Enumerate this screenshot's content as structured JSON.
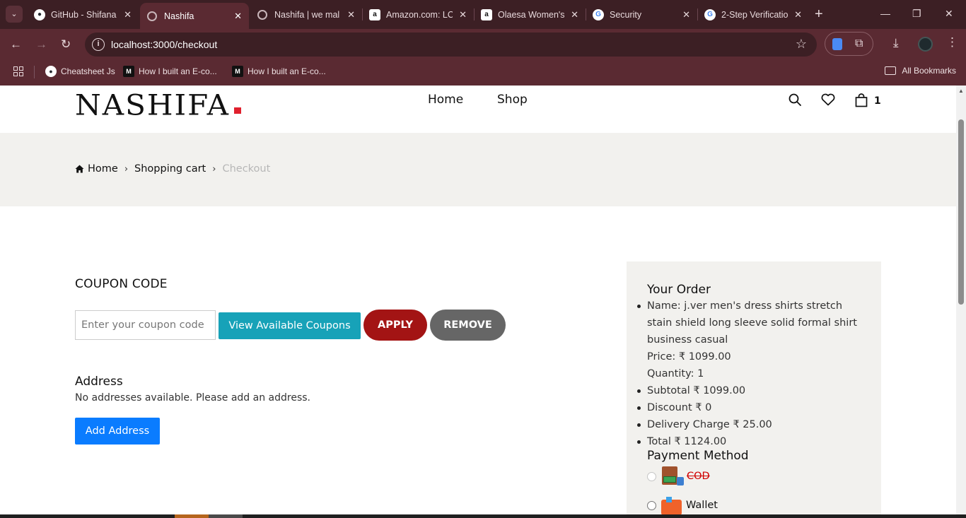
{
  "browser": {
    "tabs": [
      {
        "title": "GitHub - Shifana",
        "favicon": "github-icon"
      },
      {
        "title": "Nashifa",
        "favicon": "globe-icon",
        "active": true
      },
      {
        "title": "Nashifa | we mal",
        "favicon": "globe-icon"
      },
      {
        "title": "Amazon.com: LC",
        "favicon": "amazon-icon"
      },
      {
        "title": "Olaesa Women's",
        "favicon": "amazon-icon"
      },
      {
        "title": "Security",
        "favicon": "google-icon"
      },
      {
        "title": "2-Step Verificatio",
        "favicon": "google-icon"
      }
    ],
    "url": "localhost:3000/checkout",
    "bookmarks": [
      {
        "label": "Cheatsheet Js",
        "favicon": "github-icon"
      },
      {
        "label": "How I built an E-co...",
        "favicon": "medium-icon"
      },
      {
        "label": "How I built an E-co...",
        "favicon": "medium-icon"
      }
    ],
    "all_bookmarks_label": "All Bookmarks",
    "colors": {
      "frame": "#3c1f24",
      "toolbar": "#5a2a32"
    }
  },
  "site": {
    "logo": "NASHIFA",
    "nav": [
      {
        "label": "Home"
      },
      {
        "label": "Shop"
      }
    ],
    "cart_count": "1"
  },
  "breadcrumb": {
    "home": "Home",
    "cart": "Shopping cart",
    "current": "Checkout"
  },
  "coupon": {
    "title": "COUPON CODE",
    "placeholder": "Enter your coupon code",
    "value": "",
    "view_label": "View Available Coupons",
    "apply_label": "APPLY",
    "remove_label": "REMOVE"
  },
  "address": {
    "title": "Address",
    "empty_message": "No addresses available. Please add an address.",
    "add_label": "Add Address"
  },
  "order": {
    "title": "Your Order",
    "item_name": "Name: j.ver men's dress shirts stretch stain shield long sleeve solid formal shirt business casual",
    "item_price": "Price: ₹ 1099.00",
    "item_quantity": "Quantity: 1",
    "subtotal": "Subtotal ₹ 1099.00",
    "discount": "Discount ₹ 0",
    "delivery": "Delivery Charge ₹ 25.00",
    "total": "Total ₹ 1124.00"
  },
  "payment": {
    "title": "Payment Method",
    "options": [
      {
        "label": "COD",
        "disabled": true,
        "icon": "cash-on-delivery-icon"
      },
      {
        "label": "Wallet",
        "disabled": false,
        "icon": "wallet-icon"
      }
    ]
  },
  "colors": {
    "accent_red": "#e0202d",
    "apply": "#a31414",
    "coupons": "#17a2b8",
    "add_address": "#0a7cff",
    "remove": "#666666",
    "panel_bg": "#f2f1ee"
  }
}
